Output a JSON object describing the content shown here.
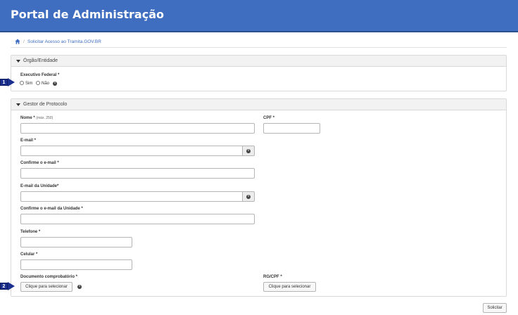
{
  "header": {
    "title": "Portal de Administração"
  },
  "breadcrumb": {
    "separator": "/",
    "link": "Solicitar Acesso ao Tramita.GOV.BR"
  },
  "orgao": {
    "title": "Órgão/Entidade",
    "executivo_label": "Executivo Federal *",
    "option_sim": "Sim",
    "option_nao": "Não"
  },
  "gestor": {
    "title": "Gestor de Protocolo",
    "nome_label": "Nome *",
    "nome_hint": "(máx. 250)",
    "cpf_label": "CPF *",
    "email_label": "E-mail *",
    "confirme_email_label": "Confirme o e-mail *",
    "email_unidade_label": "E-mail da Unidade*",
    "confirme_email_unidade_label": "Confirme o e-mail da Unidade *",
    "telefone_label": "Telefone *",
    "celular_label": "Celular *",
    "documento_label": "Documento comprobatório *",
    "documento_button": "Clique para selecionar",
    "rgcpf_label": "RG/CPF *",
    "rgcpf_button": "Clique para selecionar"
  },
  "markers": {
    "one": "1",
    "two": "2"
  },
  "info_glyph": "i",
  "footer": {
    "submit_label": "Solicitar"
  }
}
